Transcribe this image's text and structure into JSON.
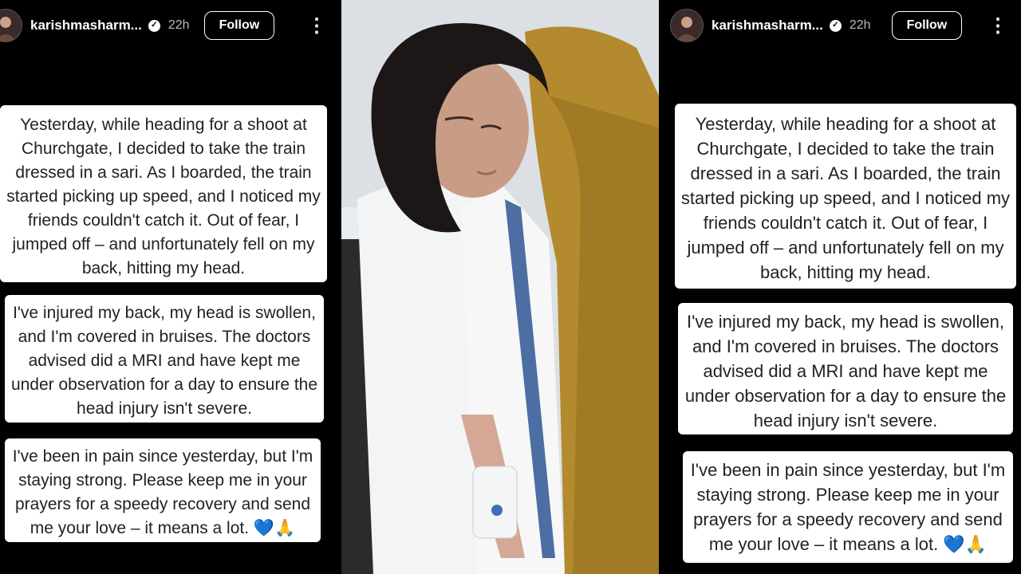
{
  "story": {
    "username": "karishmasharm...",
    "time": "22h",
    "follow_label": "Follow",
    "more_icon": "⋮",
    "verified_glyph": "✓",
    "paragraphs": [
      "Yesterday, while heading for a shoot at Churchgate, I decided to take the train dressed in a sari. As I boarded, the train started picking up speed, and I noticed my friends couldn't catch it. Out of fear, I jumped off – and unfortunately fell on my back, hitting my head.",
      "I've injured my back, my head is swollen, and I'm covered in bruises. The doctors advised did a MRI and have kept me under observation for a day to ensure the head injury isn't severe.",
      "I've been in pain since yesterday, but I'm staying strong. Please keep me in your prayers for a speedy recovery and send me your love – it means a lot. 💙🙏"
    ]
  },
  "colors": {
    "bubble_bg": "#ffffff",
    "background": "#000000",
    "text": "#222222"
  }
}
